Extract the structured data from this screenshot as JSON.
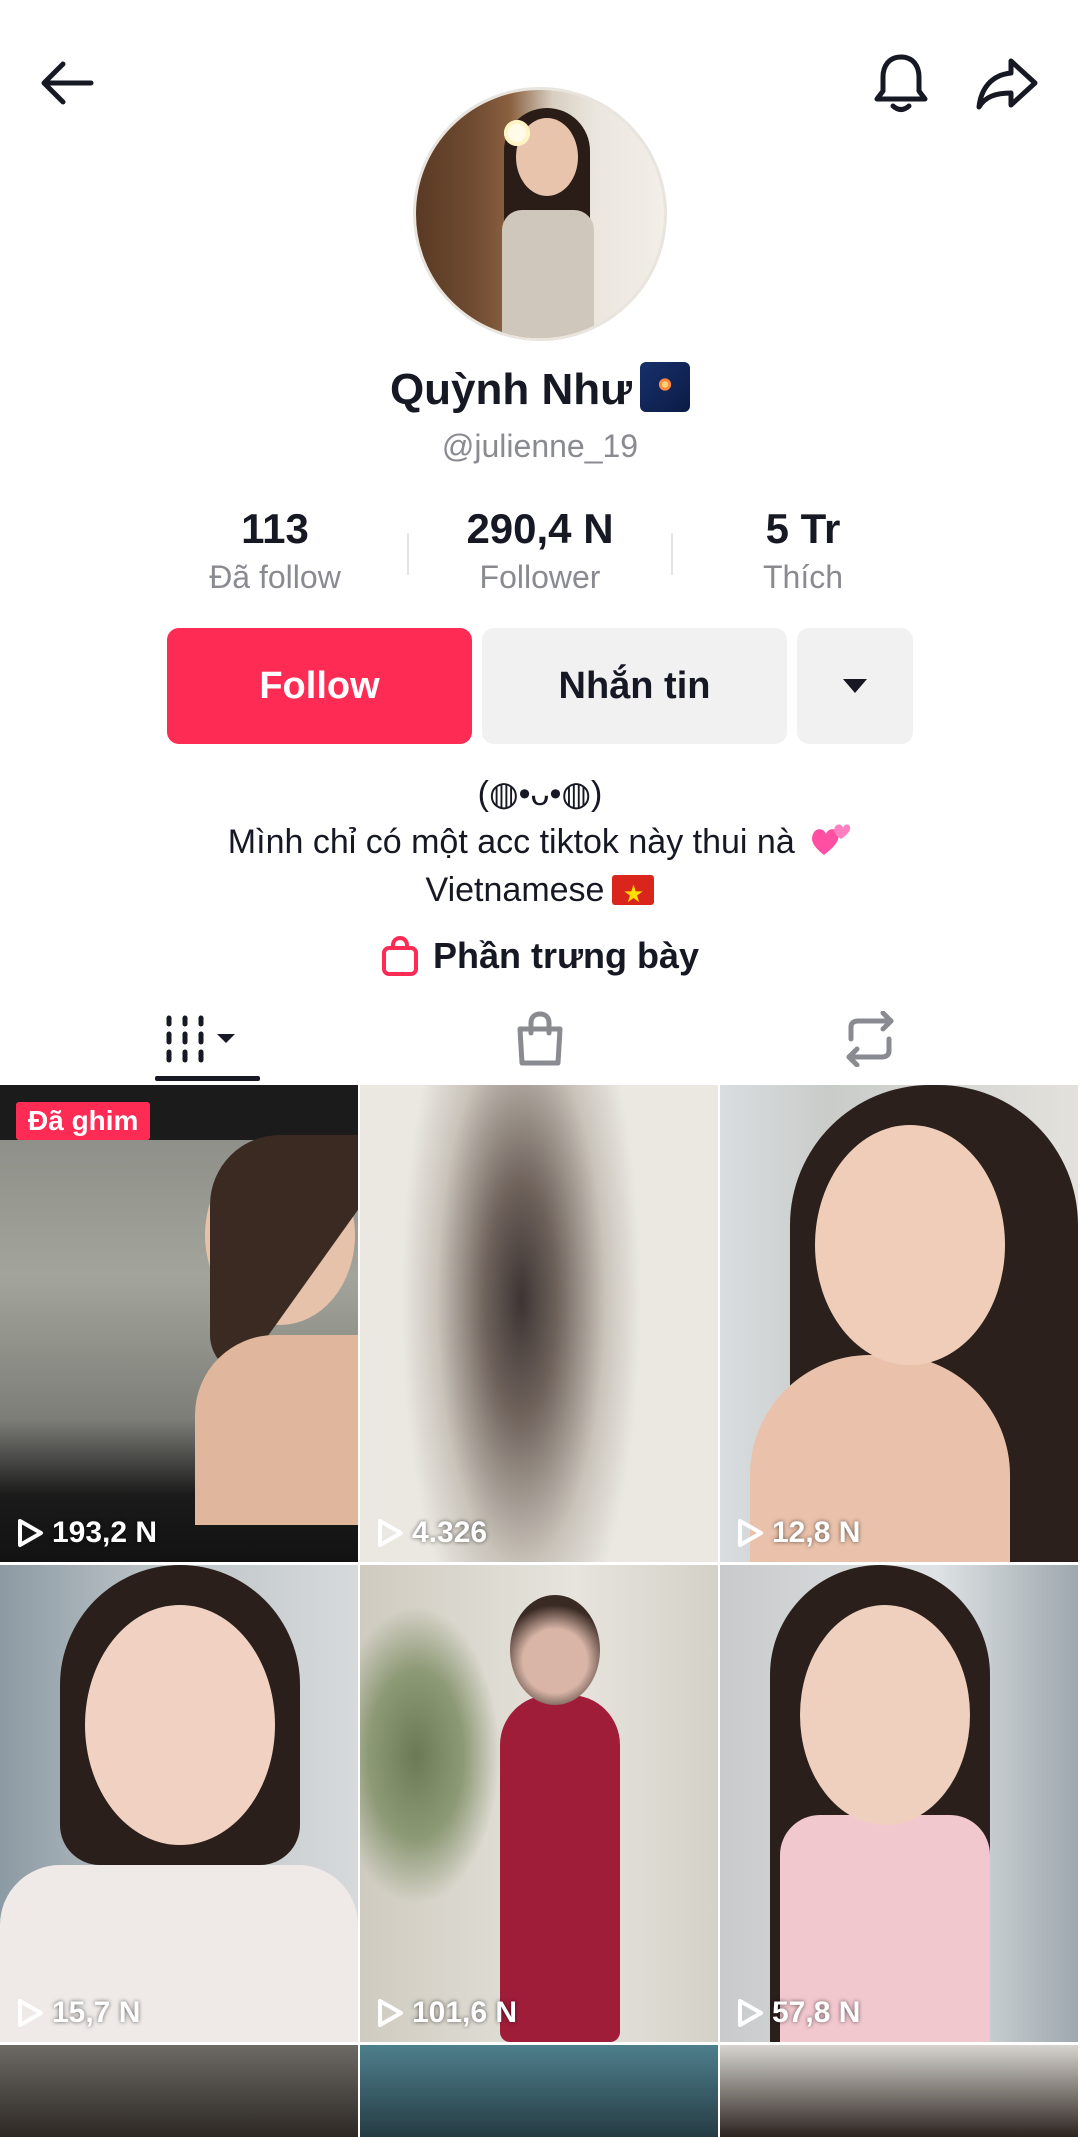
{
  "header": {
    "back_icon": "arrow-left-icon",
    "bell_icon": "bell-icon",
    "share_icon": "share-icon"
  },
  "profile": {
    "display_name": "Quỳnh Như",
    "name_emoji": "fireworks-emoji",
    "username": "@julienne_19"
  },
  "stats": {
    "following_count": "113",
    "following_label": "Đã follow",
    "followers_count": "290,4 N",
    "followers_label": "Follower",
    "likes_count": "5 Tr",
    "likes_label": "Thích"
  },
  "actions": {
    "follow_label": "Follow",
    "message_label": "Nhắn tin",
    "more_icon": "caret-down-icon"
  },
  "bio": {
    "line1": "(◍•ᴗ•◍)",
    "line2": "Mình chỉ có một acc tiktok này thui nà",
    "line3": "Vietnamese"
  },
  "showcase": {
    "label": "Phần trưng bày",
    "icon": "shopping-bag-icon"
  },
  "tabs": [
    {
      "icon": "grid-icon",
      "active": true
    },
    {
      "icon": "shopping-bag-icon",
      "active": false
    },
    {
      "icon": "repost-icon",
      "active": false
    }
  ],
  "videos": [
    {
      "views": "193,2 N",
      "pinned_label": "Đã ghim"
    },
    {
      "views": "4.326"
    },
    {
      "views": "12,8 N"
    },
    {
      "views": "15,7 N"
    },
    {
      "views": "101,6 N"
    },
    {
      "views": "57,8 N"
    }
  ],
  "colors": {
    "accent": "#fe2c55",
    "text": "#161823",
    "secondary_text": "#8a8b91",
    "button_bg": "#f1f1f2"
  }
}
